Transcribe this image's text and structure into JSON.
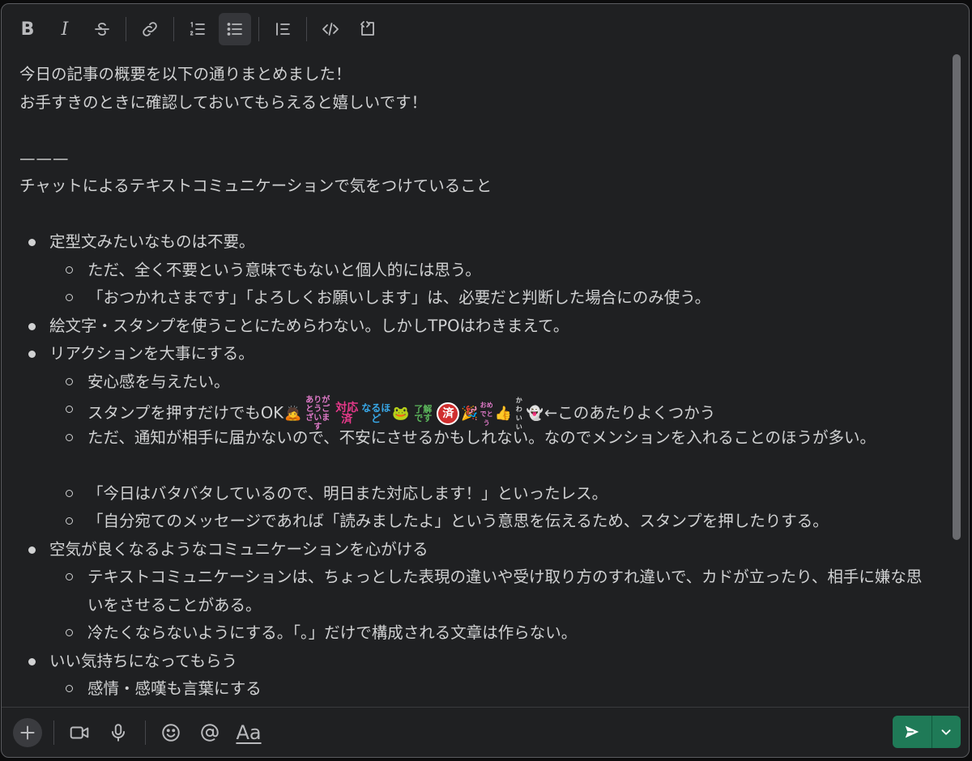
{
  "toolbar": {
    "bold": "B",
    "italic": "I"
  },
  "editor": {
    "line1": "今日の記事の概要を以下の通りまとめました！",
    "line2": "お手すきのときに確認しておいてもらえると嬉しいです！",
    "divider": "———",
    "heading": "チャットによるテキストコミュニケーションで気をつけていること",
    "b1": "定型文みたいなものは不要。",
    "b1_1": "ただ、全く不要という意味でもないと個人的には思う。",
    "b1_2": "「おつかれさまです」「よろしくお願いします」は、必要だと判断した場合にのみ使う。",
    "b2": "絵文字・スタンプを使うことにためらわない。しかしTPOはわきまえて。",
    "b3": "リアクションを大事にする。",
    "b3_1": "安心感を与えたい。",
    "b3_2_pre": "スタンプを押すだけでもOK",
    "b3_2_post": "←このあたりよくつかう",
    "b3_3": "ただ、通知が相手に届かないので、不安にさせるかもしれない。なのでメンションを入れることのほうが多い。",
    "b3_4": "「今日はバタバタしているので、明日また対応します！」といったレス。",
    "b3_5": "「自分宛てのメッセージであれば「読みましたよ」という意思を伝えるため、スタンプを押したりする。",
    "b4": "空気が良くなるようなコミュニケーションを心がける",
    "b4_1": "テキストコミュニケーションは、ちょっとした表現の違いや受け取り方のすれ違いで、カドが立ったり、相手に嫌な思いをさせることがある。",
    "b4_2": "冷たくならないようにする。「。」だけで構成される文章は作らない。",
    "b5": "いい気持ちになってもらう",
    "b5_1": "感情・感嘆も言葉にする"
  },
  "stamps": {
    "arigatou": "ありがとうございます",
    "taiou": "対応済",
    "naruhodo": "なるほど",
    "ryoukai": "了解です",
    "zumi": "済",
    "omedetou": "おめでとう",
    "kawaii": "かわいい"
  },
  "footer": {
    "format_label": "Aa"
  },
  "colors": {
    "background": "#1f2022",
    "text": "#d1d2d3",
    "send": "#1f7a57"
  }
}
